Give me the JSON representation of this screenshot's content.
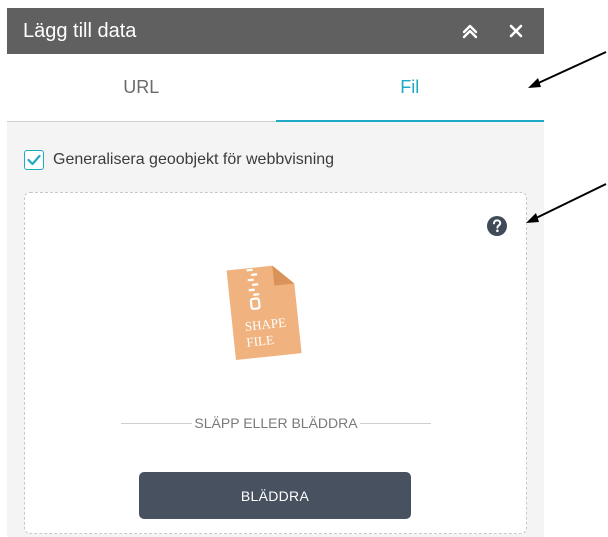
{
  "panel": {
    "title": "Lägg till data",
    "collapse_icon": "double-chevron-up-icon",
    "close_icon": "close-icon"
  },
  "tabs": [
    {
      "label": "URL",
      "active": false
    },
    {
      "label": "Fil",
      "active": true
    }
  ],
  "options": {
    "generalize_label": "Generalisera geoobjekt för webbvisning",
    "generalize_checked": true
  },
  "dropzone": {
    "help_icon": "question-mark-icon",
    "file_icon": "shapefile-zip-icon",
    "file_icon_text_line1": "SHAPE",
    "file_icon_text_line2": "FILE",
    "drop_text": "SLÄPP ELLER BLÄDDRA",
    "browse_label": "BLÄDDRA"
  },
  "annotations": {
    "arrow_icon": "annotation-arrow-icon"
  },
  "colors": {
    "header_bg": "#606060",
    "accent": "#1ea9c4",
    "button_bg": "#47515f",
    "file_icon": "#f0b27e"
  }
}
